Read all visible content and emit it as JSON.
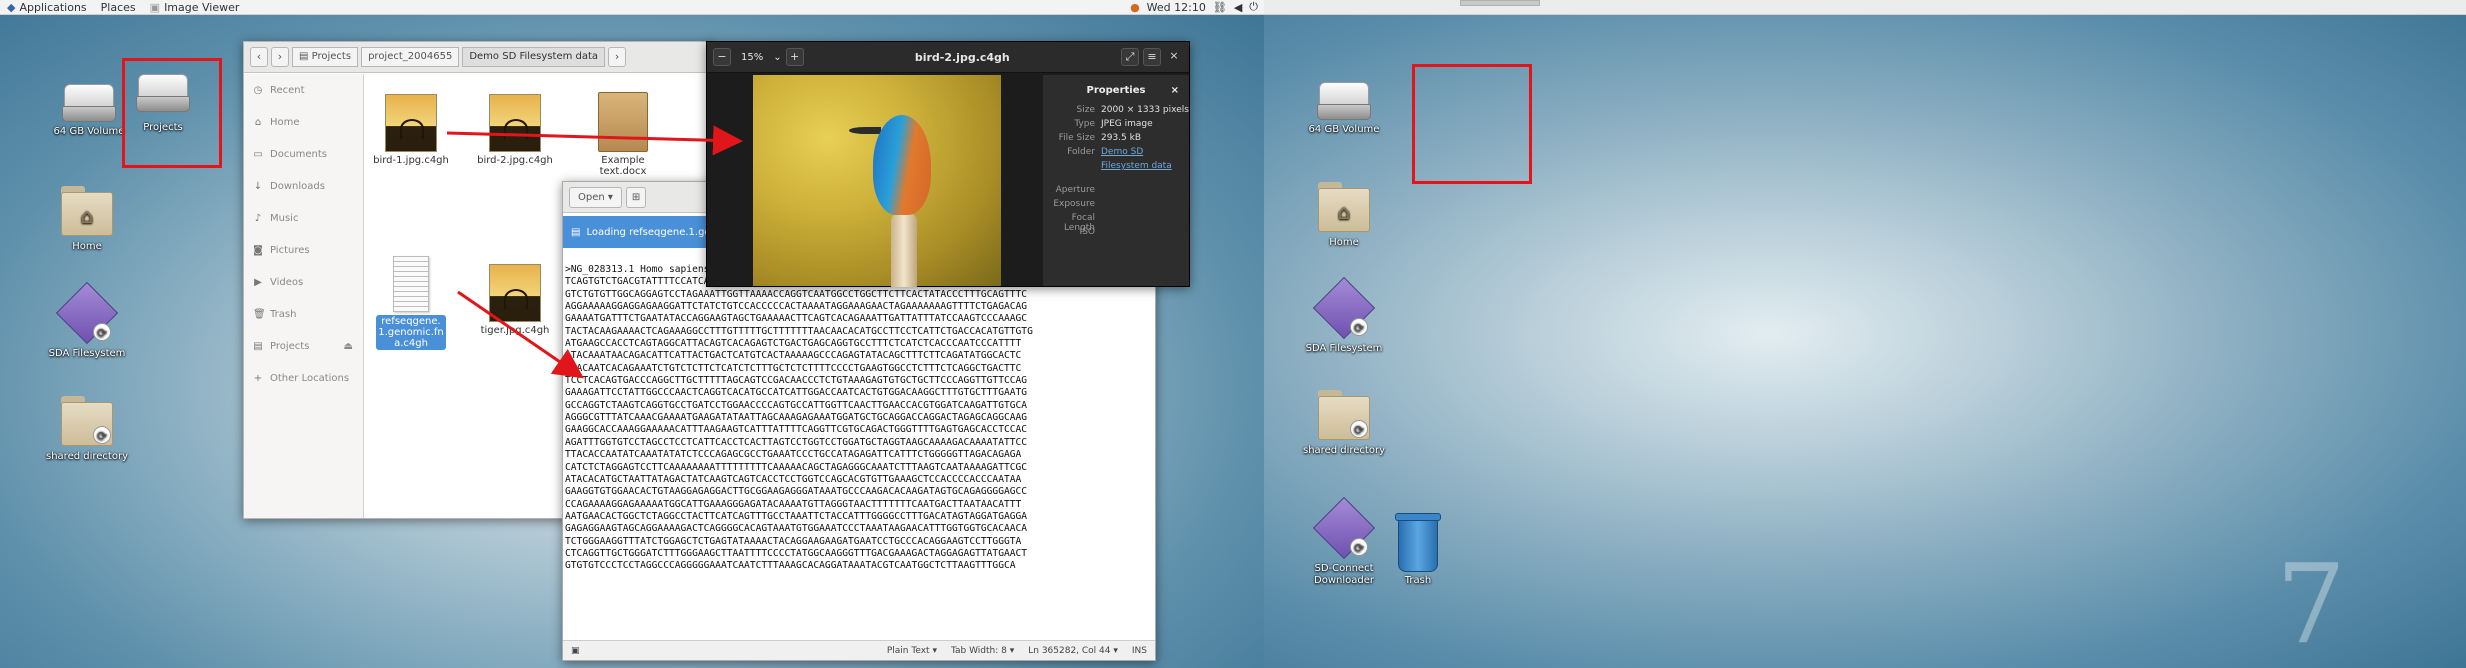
{
  "left_screen": {
    "topbar": {
      "applications": "Applications",
      "places": "Places",
      "image_viewer": "Image Viewer",
      "clock": "Wed 12:10"
    },
    "desktop_icons": {
      "volume": "64 GB Volume",
      "projects": "Projects",
      "home": "Home",
      "sda_filesystem": "SDA Filesystem",
      "shared_directory": "shared directory"
    }
  },
  "files_window": {
    "breadcrumbs": [
      "Projects",
      "project_2004655",
      "Demo SD Filesystem data"
    ],
    "sidebar": [
      "Recent",
      "Home",
      "Documents",
      "Downloads",
      "Music",
      "Pictures",
      "Videos",
      "Trash",
      "Projects",
      "Other Locations"
    ],
    "files": {
      "f1": "bird-1.jpg.c4gh",
      "f2": "bird-2.jpg.c4gh",
      "f3": "Example text.docx",
      "f4": "refseqgene.1.genomic.fna.c4gh",
      "f5": "tiger.jpg.c4gh"
    }
  },
  "viewer_window": {
    "zoom": "15%",
    "title": "bird-2.jpg.c4gh",
    "properties": {
      "heading": "Properties",
      "size_k": "Size",
      "size_v": "2000 × 1333 pixels",
      "type_k": "Type",
      "type_v": "JPEG image",
      "filesize_k": "File Size",
      "filesize_v": "293.5 kB",
      "folder_k": "Folder",
      "folder_v1": "Demo SD",
      "folder_v2": "Filesystem data",
      "aperture_k": "Aperture",
      "exposure_k": "Exposure",
      "focal_k": "Focal Length",
      "iso_k": "ISO"
    }
  },
  "editor_window": {
    "open_label": "Open",
    "loading": "Loading refseqgene.1.genomic.fna.c4gh...",
    "code": ">NG_028313.1 Homo sapiens\nTCAGTGTCTGACGTATTTTCCATCAGTACTTTTTTTGGGTACAGTGGCAGTAAAATGTGTTAGGGTTCCCTCCTC\nGTCTGTGTTGGCAGGAGTCCTAGAAATTGGTTAAAACCAGGTCAATGGCCTGGCTTCTTCACTATACCCTTTGCAGTTTC\nAGGAAAAAGGAGGAGAAGGATTCTATCTGTCCACCCCCACTAAAATAGGAAAGAACTAGAAAAAAAGTTTTCTGAGACAG\nGAAAATGATTTCTGAATATACCAGGAAGTAGCTGAAAAACTTCAGTCACAGAAATTGATTATTTATCCAAGTCCCAAAGC\nTACTACAAGAAAACTCAGAAAGGCCTTTGTTTTTGCTTTTTTTAACAACACATGCCTTCCTCATTCTGACCACATGTTGTG\nATGAAGCCACCTCAGTAGGCATTACAGTCACAGAGTCTGACTGAGCAGGTGCCTTTCTCATCTCACCCAATCCCATTTT\nATACAAATAACAGACATTCATTACTGACTCATGTCACTAAAAAGCCCAGAGTATACAGCTTTCTTCAGATATGGCACTC\nTAACAATCACAGAAATCTGTCTCTTCTCATCTCTTTGCTCTCTTTTCCCCTGAAGTGGCCTCTTTCTCAGGCTGACTTC\nTCCTCACAGTGACCCAGGCTTGCTTTTTAGCAGTCCGACAACCCTCTGTAAAGAGTGTGCTGCTTCCCAGGTTGTTCCAG\nGAAAGATTCCTATTGGCCCAACTCAGGTCACATGCCATCATTGGACCAATCACTGTGGACAAGGCTTTGTGCTTTGAATG\nGCCAGGTCTAAGTCAGGTGCCTGATCCTGGAACCCCAGTGCCATTGGTTCAACTTGAACCACGTGGATCAAGATTGTGCA\nAGGGCGTTTATCAAACGAAAATGAAGATATAATTAGCAAAGAGAAATGGATGCTGCAGGACCAGGACTAGAGCAGGCAAG\nGAAGGCACCAAAGGAAAAACATTTAAGAAGTCATTTATTTTCAGGTTCGTGCAGACTGGGTTTTGAGTGAGCACCTCCAC\nAGATTTGGTGTCCTAGCCTCCTCATTCACCTCACTTAGTCCTGGTCCTGGATGCTAGGTAAGCAAAAGACAAAATATTCC\nTTACACCAATATCAAATATATCTCCCAGAGCGCCTGAAATCCCTGCCATAGAGATTCATTTCTGGGGGTTAGACAGAGA\nCATCTCTAGGAGTCCTTCAAAAAAAATTTTTTTTTCAAAAACAGCTAGAGGGCAAATCTTTAAGTCAATAAAAGATTCGC\nATACACATGCTAATTATAGACTATCAAGTCAGTCACCTCCTGGTCCAGCACGTGTTGAAAGCTCCACCCCACCCAATAA\nGAAGGTGTGGAACACTGTAAGGAGAGGACTTGCGGAAGAGGGATAAATGCCCAAGACACAAGATAGTGCAGAGGGGAGCC\nCCAGAAAAGGAGAAAAATGGCATTGAAAGGGAGATACAAAATGTTAGGGTAACTTTTTTTCAATGACTTAATAACATTT\nAATGAACACTGGCTCTAGGCCTACTTCATCAGTTTGCCTAAATTCTACCATTTGGGGCCTTTGACATAGTAGGATGAGGA\nGAGAGGAAGTAGCAGGAAAAGACTCAGGGGCACAGTAAATGTGGAAATCCCTAAATAAGAACATTTGGTGGTGCACAACA\nTCTGGGAAGGTTTATCTGGAGCTCTGAGTATAAAACTACAGGAAGAAGATGAATCCTGCCCACAGGAAGTCCTTGGGTA\nCTCAGGTTGCTGGGATCTTTGGGAAGCTTAATTTTCCCCTATGGCAAGGGTTTGACGAAAGACTAGGAGAGTTATGAACT\nGTGTGTCCCTCCTAGGCCCAGGGGGAAATCAATCTTTAAAGCACAGGATAAATACGTCAATGGCTCTTAAGTTTGGCA",
    "statusbar": {
      "plain_text": "Plain Text",
      "tab_width": "Tab Width: 8",
      "position": "Ln 365282, Col 44",
      "ins": "INS"
    }
  },
  "right_screen": {
    "desktop_icons": {
      "volume": "64 GB Volume",
      "home": "Home",
      "sda_filesystem": "SDA Filesystem",
      "shared_directory": "shared directory",
      "sd_connect": "SD-Connect Downloader",
      "trash": "Trash"
    },
    "workspace_number": "7"
  },
  "colors": {
    "highlight_red": "#e0161b",
    "selection_blue": "#4a90d9"
  }
}
